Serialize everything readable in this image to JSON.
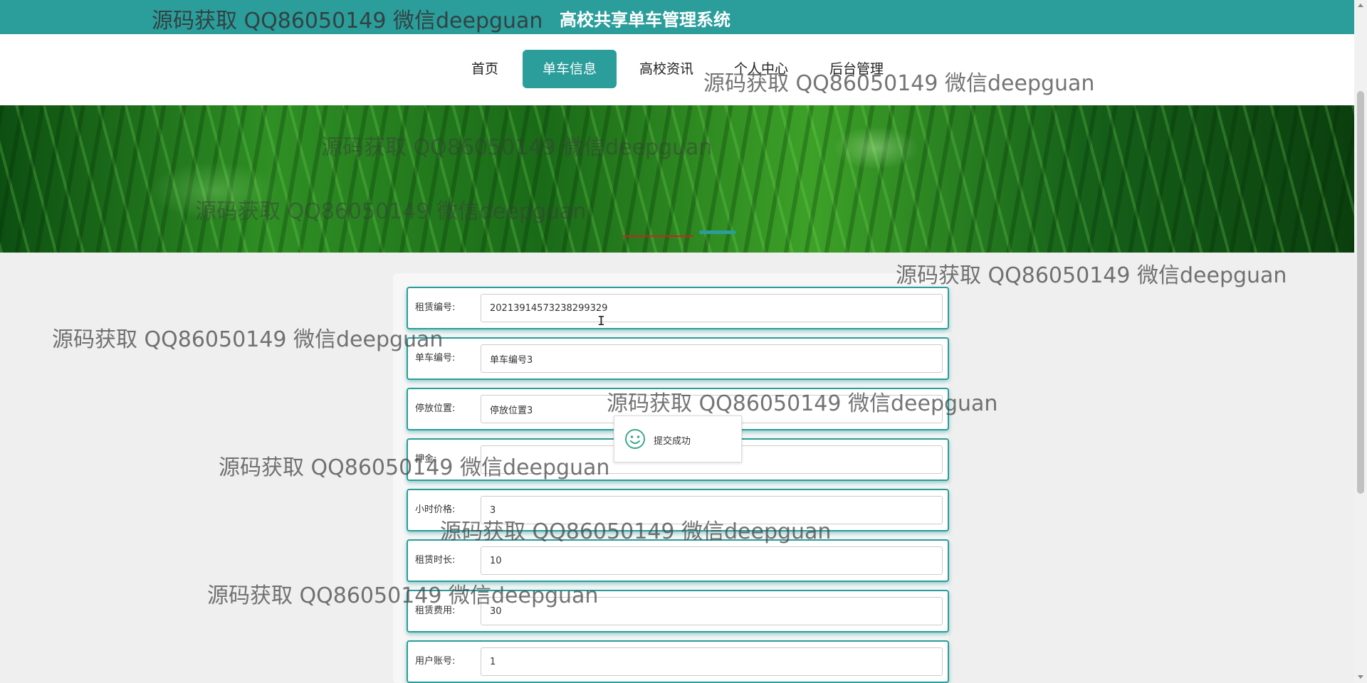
{
  "site_title": "高校共享单车管理系统",
  "nav": {
    "items": [
      {
        "label": "首页",
        "active": false
      },
      {
        "label": "单车信息",
        "active": true
      },
      {
        "label": "高校资讯",
        "active": false
      },
      {
        "label": "个人中心",
        "active": false
      },
      {
        "label": "后台管理",
        "active": false
      }
    ]
  },
  "banner": {
    "slide_count": 2,
    "active_slide": 1
  },
  "form": {
    "fields": [
      {
        "label": "租赁编号:",
        "value": "20213914573238299329"
      },
      {
        "label": "单车编号:",
        "value": "单车编号3"
      },
      {
        "label": "停放位置:",
        "value": "停放位置3"
      },
      {
        "label": "押金:",
        "value": ""
      },
      {
        "label": "小时价格:",
        "value": "3"
      },
      {
        "label": "租赁时长:",
        "value": "10"
      },
      {
        "label": "租赁费用:",
        "value": "30"
      },
      {
        "label": "用户账号:",
        "value": "1"
      }
    ]
  },
  "toast": {
    "icon": "smile-icon",
    "message": "提交成功"
  },
  "watermark": "源码获取 QQ86050149 微信deepguan",
  "colors": {
    "accent": "#2b9d9b",
    "background": "#efefef",
    "toast_icon": "#3daa8a"
  }
}
